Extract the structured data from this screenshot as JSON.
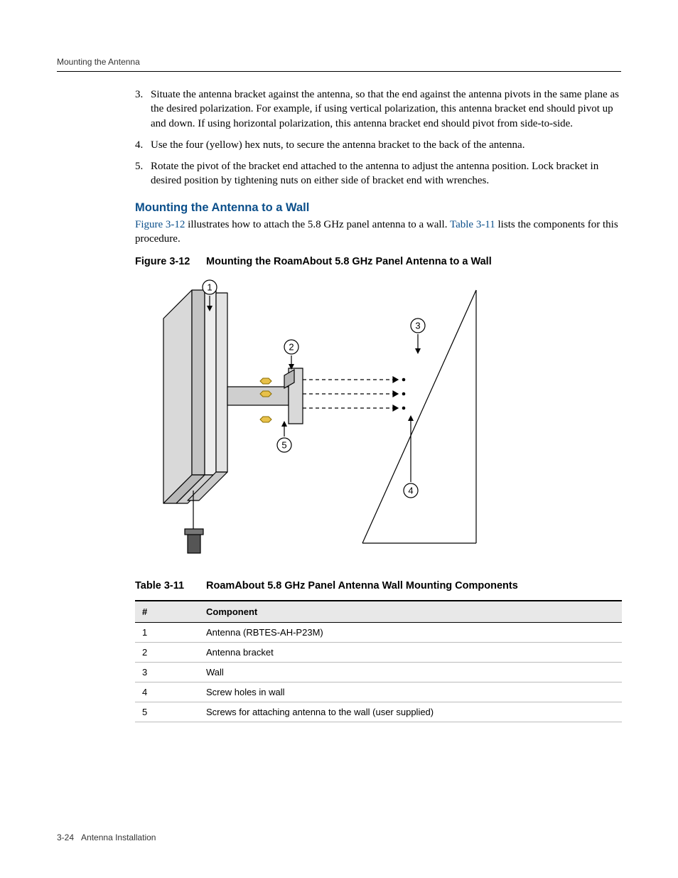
{
  "header": {
    "running_head": "Mounting the Antenna"
  },
  "steps": {
    "s3": "Situate the antenna bracket against the antenna, so that the end against the antenna pivots in the same plane as the desired polarization. For example, if using vertical polarization, this antenna bracket end should pivot up and down. If using horizontal polarization, this antenna bracket end should pivot from side‑to‑side.",
    "s4": "Use the four (yellow) hex nuts, to secure the antenna bracket to the back of the antenna.",
    "s5": "Rotate the pivot of the bracket end attached to the antenna to adjust the antenna position. Lock bracket in desired position by tightening nuts on either side of bracket end with wrenches."
  },
  "section": {
    "heading": "Mounting the Antenna to a Wall",
    "para_pre": "",
    "fig_ref": "Figure 3‑12",
    "para_mid": " illustrates how to attach the 5.8 GHz panel antenna to a wall. ",
    "tbl_ref": "Table 3‑11",
    "para_post": " lists the components for this procedure."
  },
  "figure": {
    "label": "Figure 3-12",
    "title": "Mounting the RoamAbout 5.8 GHz Panel Antenna to a Wall",
    "callouts": {
      "c1": "1",
      "c2": "2",
      "c3": "3",
      "c4": "4",
      "c5": "5"
    }
  },
  "table": {
    "label": "Table 3-11",
    "title": "RoamAbout 5.8 GHz Panel Antenna Wall Mounting Components",
    "head_num": "#",
    "head_comp": "Component",
    "rows": [
      {
        "num": "1",
        "comp": "Antenna (RBTES-AH-P23M)"
      },
      {
        "num": "2",
        "comp": "Antenna bracket"
      },
      {
        "num": "3",
        "comp": "Wall"
      },
      {
        "num": "4",
        "comp": "Screw holes in wall"
      },
      {
        "num": "5",
        "comp": "Screws for attaching antenna to the wall (user supplied)"
      }
    ]
  },
  "footer": {
    "page_num": "3-24",
    "chapter": "Antenna Installation"
  }
}
